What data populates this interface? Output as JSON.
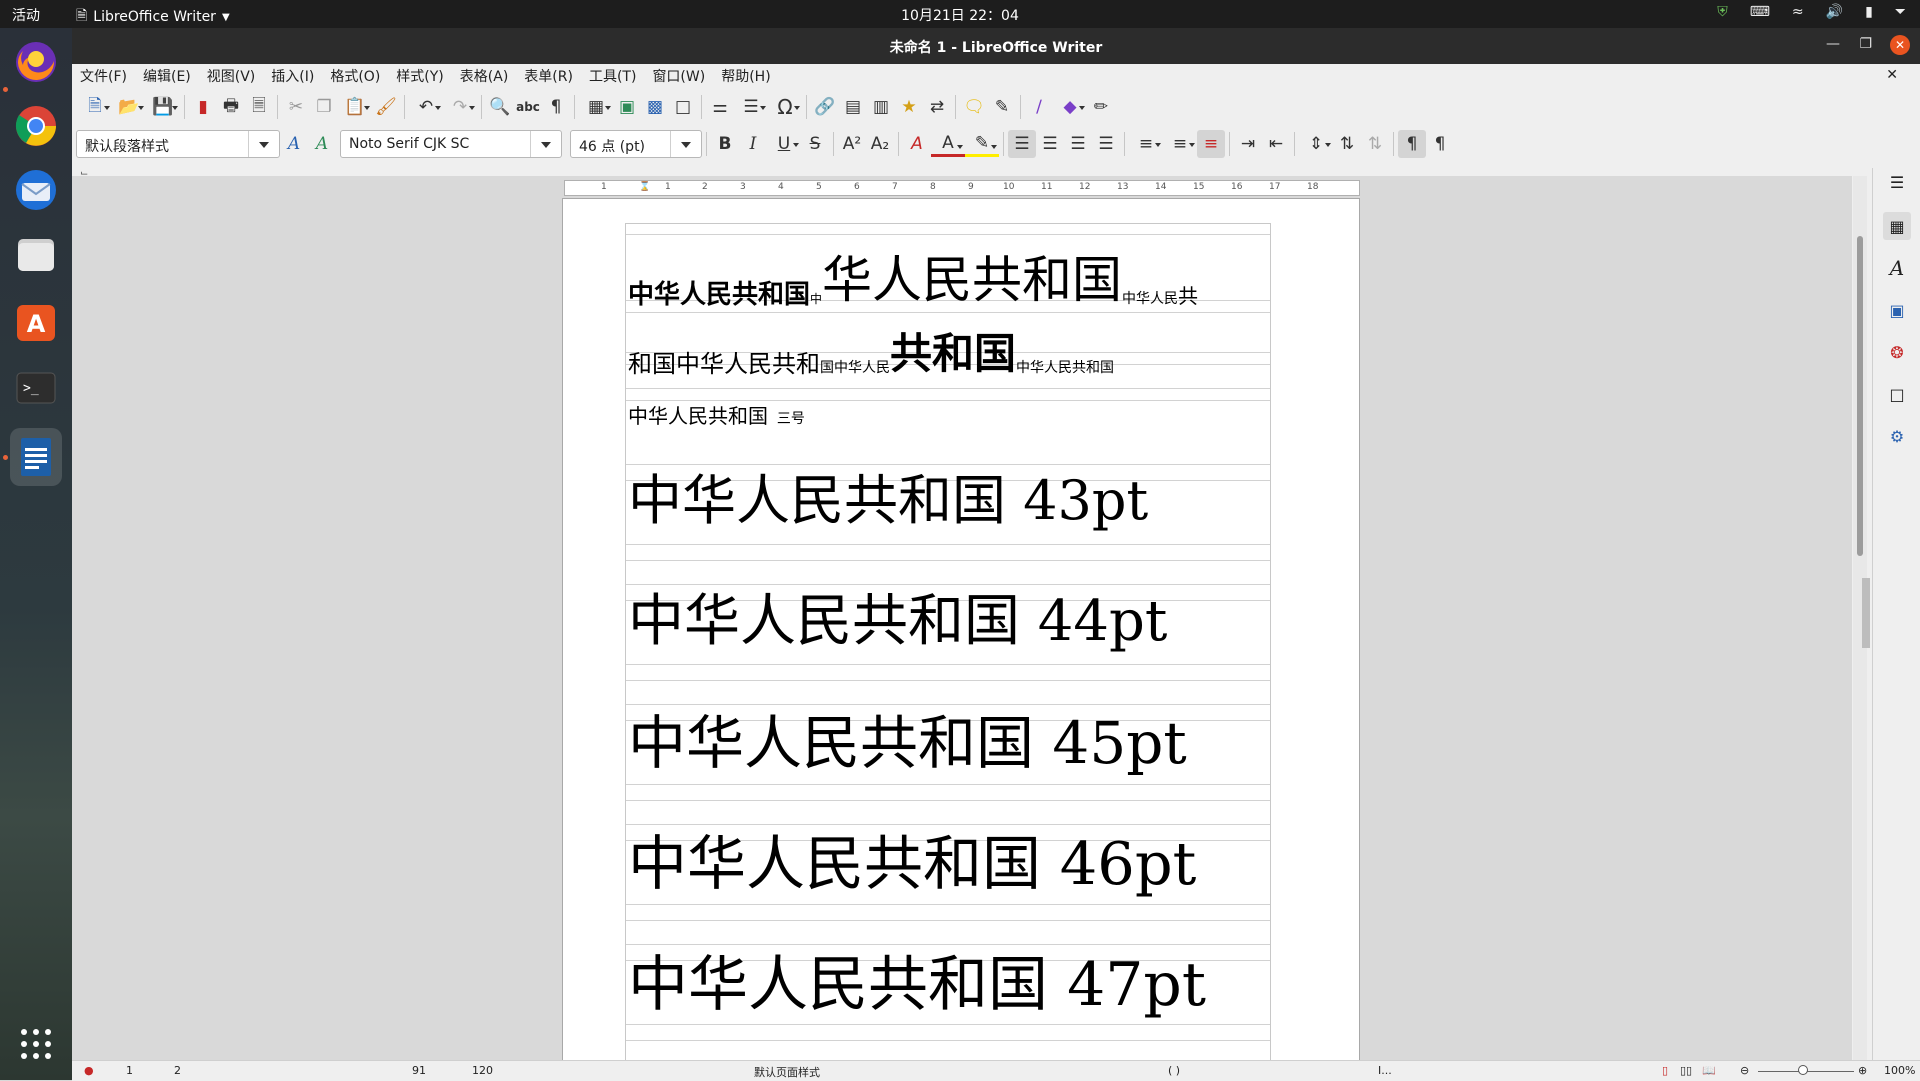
{
  "topbar": {
    "activities": "活动",
    "app": "LibreOffice Writer",
    "clock": "10月21日  22：04"
  },
  "window": {
    "title": "未命名 1 - LibreOffice Writer"
  },
  "menu": [
    "文件(F)",
    "编辑(E)",
    "视图(V)",
    "插入(I)",
    "格式(O)",
    "样式(Y)",
    "表格(A)",
    "表单(R)",
    "工具(T)",
    "窗口(W)",
    "帮助(H)"
  ],
  "format": {
    "paragraph_style": "默认段落样式",
    "font_name": "Noto Serif CJK SC",
    "font_size": "46 点 (pt)"
  },
  "ruler": [
    "1",
    "1",
    "2",
    "3",
    "4",
    "5",
    "6",
    "7",
    "8",
    "9",
    "10",
    "11",
    "12",
    "13",
    "14",
    "15",
    "16",
    "17",
    "18"
  ],
  "doc": {
    "l1a": "中华人民共和国",
    "l1b": "中",
    "l1c": "华人民共和国",
    "l1d": "中华人民",
    "l1e": "共",
    "l2a": "和国",
    "l2b": "中华人民共和",
    "l2c": "国中华人民",
    "l2d": "共和国",
    "l2e": "中华人民共和国",
    "l3a": "中华人民共和国",
    "l3b": "三号",
    "l4": "中华人民共和国  43pt",
    "l5": "中华人民共和国  44pt",
    "l6": "中华人民共和国  45pt",
    "l7": "中华人民共和国  46pt",
    "l8": "中华人民共和国   47pt"
  },
  "status": {
    "page": "1",
    "pages": "2",
    "words": "91",
    "chars": "120",
    "page_style": "默认页面样式",
    "lang": "(     )",
    "mode": "I...",
    "zoom": "100%"
  }
}
